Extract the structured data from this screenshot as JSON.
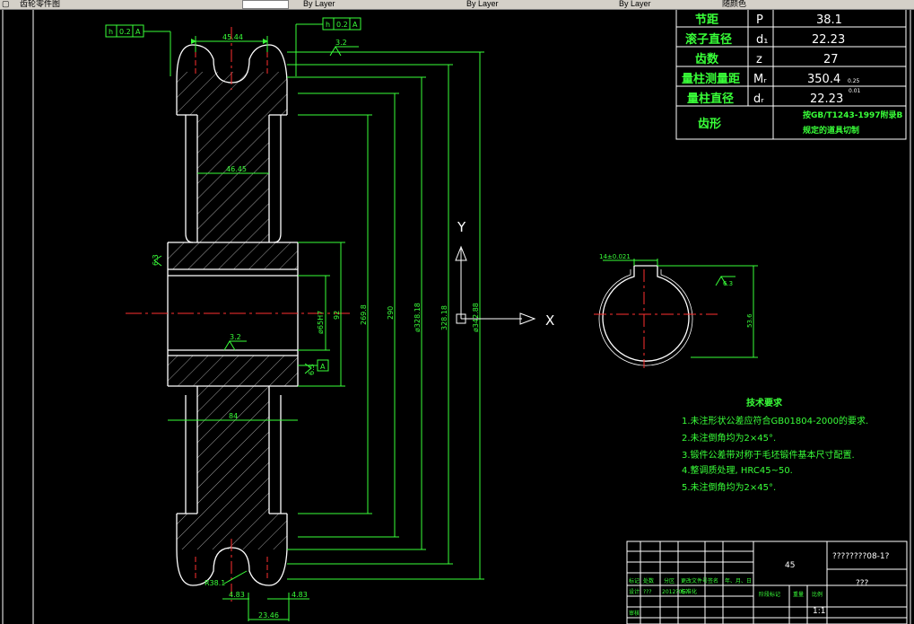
{
  "window": {
    "toolbar": {
      "file_tab_label": "齿轮零件图",
      "dropdown1_value": "By Layer",
      "dropdown2_value": "By Layer",
      "dropdown3_value": "By Layer",
      "dropdown4_value": "随颜色"
    }
  },
  "params_table": {
    "rows": [
      {
        "label": "节距",
        "symbol": "P",
        "value": "38.1"
      },
      {
        "label": "滚子直径",
        "symbol": "d₁",
        "value": "22.23"
      },
      {
        "label": "齿数",
        "symbol": "z",
        "value": "27"
      },
      {
        "label": "量柱测量距",
        "symbol": "Mᵣ",
        "value": "350.4",
        "tol": "0.25"
      },
      {
        "label": "量柱直径",
        "symbol": "dᵣ",
        "value": "22.23",
        "tol": "0.01"
      }
    ],
    "tooth_form_label": "齿形",
    "tooth_form_value_1": "按GB/T1243-1997附录B",
    "tooth_form_value_2": "规定的道具切制"
  },
  "tech_requirements": {
    "title": "技术要求",
    "items": [
      "1.未注形状公差应符合GB01804-2000的要求.",
      "2.未注倒角均为2×45°.",
      "3.锻件公差带对称于毛坯锻件基本尺寸配置.",
      "4.整调质处理, HRC45~50.",
      "5.未注倒角均为2×45°."
    ]
  },
  "title_block": {
    "material": "45",
    "drawing_number": "????????08-1?",
    "name": "???",
    "scale": "1:1",
    "header_cells": [
      "标记",
      "处数",
      "分区",
      "更改文件号",
      "签名",
      "年、月、日"
    ],
    "row2_cells": [
      "设计",
      "???",
      "2012?05?",
      "标准化"
    ],
    "stage_label": "阶段标记",
    "weight_label": "重量",
    "scale_label": "比例",
    "review_label": "审核"
  },
  "annotations": {
    "gdt_frame_1": [
      "h",
      "0.2",
      "A"
    ],
    "gdt_frame_2": [
      "h",
      "0.2",
      "A"
    ],
    "dim_top_width": "45.44",
    "dim_inner_width": "46.45",
    "dim_hub_width": "84",
    "dim_bottom_width": "23.46",
    "dim_r": "R38.1",
    "dim_left_small": "4.83",
    "dim_right_small": "4.83",
    "rough_top": "3.2",
    "rough_hub": "3.2",
    "rough_left": "6.3",
    "rough_right": "6.3",
    "datum_a": "A",
    "dim_bore": "ø65H7",
    "dim_92": "92",
    "dim_2698": "269.8",
    "dim_290": "290",
    "dim_da": "ø328.18",
    "dim_d": "328.18",
    "dim_dout": "ø342.88",
    "axis_y": "Y",
    "axis_x": "X",
    "keyway_width": "14±0.021",
    "keyway_rough": "6.3",
    "keyway_depth": "53.6"
  }
}
